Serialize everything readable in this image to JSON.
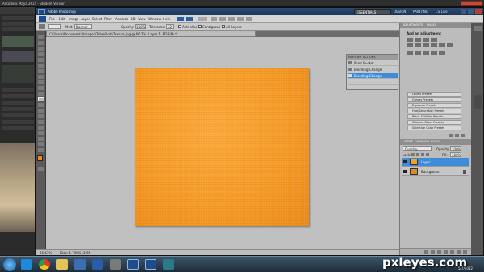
{
  "outer_window": {
    "title": "Autodesk Maya 2012 - Student Version"
  },
  "photoshop": {
    "title": "Adobe Photoshop",
    "menu": [
      "File",
      "Edit",
      "Image",
      "Layer",
      "Select",
      "Filter",
      "Analysis",
      "3D",
      "View",
      "Window",
      "Help"
    ],
    "workspace_buttons": [
      "ESSENTIALS",
      "DESIGN",
      "PAINTING"
    ],
    "cs_live": "CS Live",
    "options": {
      "mode_label": "Mode:",
      "mode_value": "Normal",
      "opacity_label": "Opacity:",
      "opacity_value": "100%",
      "tolerance_label": "Tolerance:",
      "tolerance_value": "32",
      "antialias_label": "Anti-alias",
      "contiguous_label": "Contiguous",
      "all_layers_label": "All Layers"
    },
    "document_tab": "C:\\Users\\Documents\\Images\\TableClothTexture.jpg @ 66.7% (Layer 1, RGB/8) *",
    "status": {
      "zoom": "66.67%",
      "doc_size": "Doc: 1.79M/2.32M"
    },
    "history": {
      "tabs": [
        "HISTORY",
        "ACTIONS"
      ],
      "items": [
        "Paint Bucket",
        "Blending Change",
        "Blending Change",
        "",
        ""
      ]
    },
    "adjustments": {
      "tabs": [
        "ADJUSTMENTS",
        "MASKS"
      ],
      "title": "Add an adjustment",
      "presets": [
        "Levels Presets",
        "Curves Presets",
        "Exposure Presets",
        "Hue/Saturation Presets",
        "Black & White Presets",
        "Channel Mixer Presets",
        "Selective Color Presets"
      ]
    },
    "layers": {
      "tabs": [
        "LAYERS",
        "CHANNELS",
        "PATHS"
      ],
      "blend_mode": "Overlay",
      "opacity_label": "Opacity:",
      "opacity_value": "100%",
      "lock_label": "Lock:",
      "fill_label": "Fill:",
      "fill_value": "100%",
      "items": [
        {
          "name": "Layer 1",
          "selected": true,
          "thumb_color": "#f5a02c"
        },
        {
          "name": "Background",
          "selected": false,
          "thumb_color": "#d48a34"
        }
      ]
    }
  },
  "taskbar": {
    "clock_time": "",
    "clock_date": "5/7/2012",
    "icons": [
      "start-orb-icon",
      "ie-icon",
      "chrome-icon",
      "folder-icon",
      "media-icon",
      "word-icon",
      "app-icon",
      "photoshop-icon",
      "photoshop-icon",
      "maya-icon"
    ]
  },
  "watermark": "pxleyes.com",
  "colors": {
    "canvas_fill": "#f59a26",
    "selection_blue": "#3d8bd9",
    "taskbar": "#2a3c4c"
  }
}
